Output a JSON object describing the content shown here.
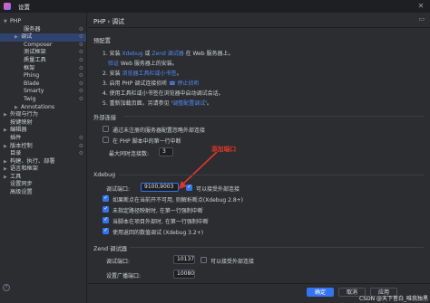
{
  "window": {
    "title": "设置",
    "close_glyph": "✕"
  },
  "sidebar": {
    "items": [
      {
        "label": "PHP",
        "expanded": true
      },
      {
        "label": "服务器"
      },
      {
        "label": "调试",
        "selected": true
      },
      {
        "label": "Composer"
      },
      {
        "label": "测试框架"
      },
      {
        "label": "质量工具"
      },
      {
        "label": "框架"
      },
      {
        "label": "Phing"
      },
      {
        "label": "Blade"
      },
      {
        "label": "Smarty"
      },
      {
        "label": "Twig"
      },
      {
        "label": "Annotations"
      },
      {
        "label": "外观与行为"
      },
      {
        "label": "按键映射"
      },
      {
        "label": "编辑器"
      },
      {
        "label": "插件"
      },
      {
        "label": "版本控制"
      },
      {
        "label": "目录"
      },
      {
        "label": "构建、执行、部署"
      },
      {
        "label": "语言和框架"
      },
      {
        "label": "工具"
      },
      {
        "label": "设置同步"
      },
      {
        "label": "高级设置"
      }
    ]
  },
  "breadcrumb": {
    "part1": "PHP",
    "sep": "›",
    "part2": "调试"
  },
  "pre_config": {
    "title": "预配置",
    "step1_prefix": "1. 安装 ",
    "step1_link1": "Xdebug",
    "step1_mid": " 或 ",
    "step1_link2": "Zend 调试器",
    "step1_suffix": " 在 Web 服务器上。",
    "step1b_link": "验证",
    "step1b_suffix": " Web 服务器上的安装。",
    "step2_prefix": "2. 安装 ",
    "step2_link": "浏览器工具栏或小书签",
    "step2_suffix": "。",
    "step3_prefix": "3. 启用 PHP 调试连接侦听 ",
    "step3_link": "停止侦听",
    "step4_text": "4. 使用工具栏或小书签在浏览器中启动调试会话。",
    "step5_prefix": "5. 重新加载页面。另请参见 '",
    "step5_link": "调整配置调试",
    "step5_suffix": "'。"
  },
  "external": {
    "title": "外部连接",
    "cb1_label": "通过未注册的服务器配置忽略外部连接",
    "cb2_label": "在 PHP 脚本中的第一行中断",
    "max_conn_label": "最大同时连接数:",
    "max_conn_value": "3"
  },
  "annotation": "添加端口",
  "xdebug": {
    "title": "Xdebug",
    "port_label": "调试端口:",
    "port_value": "9100,9003",
    "accept_label": "可以接受外部连接",
    "cb_a_label": "如果断点在当前开不可用, 则解析断点(Xdebug 2.8+)",
    "cb_b_label": "未指定路径映射时, 在第一行强制中断",
    "cb_c_label": "当脚本在项目外部时, 在第一行强制中断",
    "cb_d_label": "使用返回的数值调试 (Xdebug 3.2+)"
  },
  "zend": {
    "title": "Zend 调试器",
    "port_label": "调试端口:",
    "port_value": "10137",
    "accept_label": "可以接受外部连接",
    "broadcast_label": "设置广播端口:",
    "broadcast_value": "10080"
  },
  "footer": {
    "ok": "确定",
    "cancel": "取消",
    "apply": "应用",
    "help": "?"
  },
  "watermark": "CSDN @天下皆白_唯我独黑",
  "colors": {
    "accent": "#3574f0",
    "link": "#548af7",
    "annotation": "#e0362a",
    "background": "#2b2d30"
  }
}
